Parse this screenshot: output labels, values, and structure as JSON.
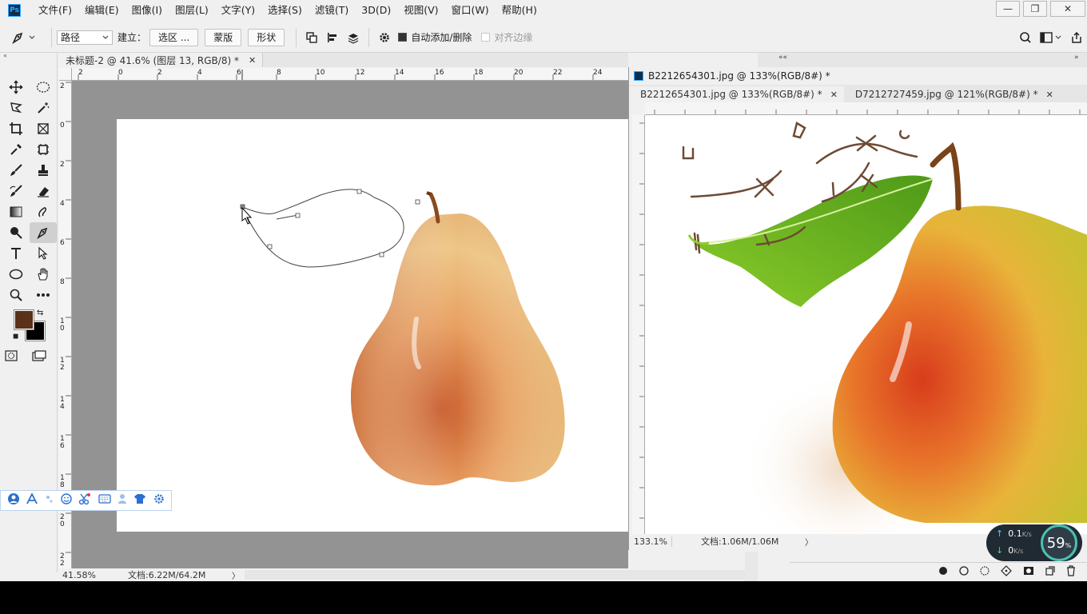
{
  "app": {
    "logo": "Ps"
  },
  "menu": [
    "文件(F)",
    "编辑(E)",
    "图像(I)",
    "图层(L)",
    "文字(Y)",
    "选择(S)",
    "滤镜(T)",
    "3D(D)",
    "视图(V)",
    "窗口(W)",
    "帮助(H)"
  ],
  "window_controls": {
    "minimize": "—",
    "restore": "❐",
    "close": "✕"
  },
  "options": {
    "mode": "路径",
    "build_label": "建立：",
    "selection_btn": "选区 ...",
    "mask_btn": "蒙版",
    "shape_btn": "形状",
    "auto_add_delete": "自动添加/删除",
    "align_edges": "对齐边缘"
  },
  "main_doc": {
    "tab_title": "未标题-2 @ 41.6% (图层 13, RGB/8) *",
    "tab_close": "✕",
    "zoom": "41.58%",
    "doc_info": "文档:6.22M/64.2M",
    "arrow": "〉",
    "ruler_h": [
      "2",
      "0",
      "2",
      "4",
      "6",
      "8",
      "10",
      "12",
      "14",
      "16",
      "18",
      "20",
      "22",
      "24"
    ],
    "ruler_v": [
      "2",
      "0",
      "2",
      "4",
      "6",
      "8",
      "1\n0",
      "1\n2",
      "1\n4",
      "1\n6",
      "1\n8",
      "2\n0",
      "2\n2"
    ]
  },
  "second_doc": {
    "window_title": "B2212654301.jpg @ 133%(RGB/8#) *",
    "tabs": [
      {
        "label": "B2212654301.jpg @ 133%(RGB/8#) *",
        "close": "✕"
      },
      {
        "label": "D7212727459.jpg @ 121%(RGB/8#) *",
        "close": "✕"
      }
    ],
    "zoom": "133.1%",
    "doc_info": "文档:1.06M/1.06M",
    "arrow": "〉"
  },
  "panel_collapse": {
    "left": "«",
    "right": "»",
    "strip": "««"
  },
  "network": {
    "up_value": "0.1",
    "up_unit": "K/s",
    "down_value": "0",
    "down_unit": "K/s",
    "percent": "59",
    "percent_unit": "%"
  },
  "colors": {
    "foreground": "#5a3219",
    "background": "#000000",
    "canvas_bg": "#939393",
    "accent": "#31a8ff"
  }
}
